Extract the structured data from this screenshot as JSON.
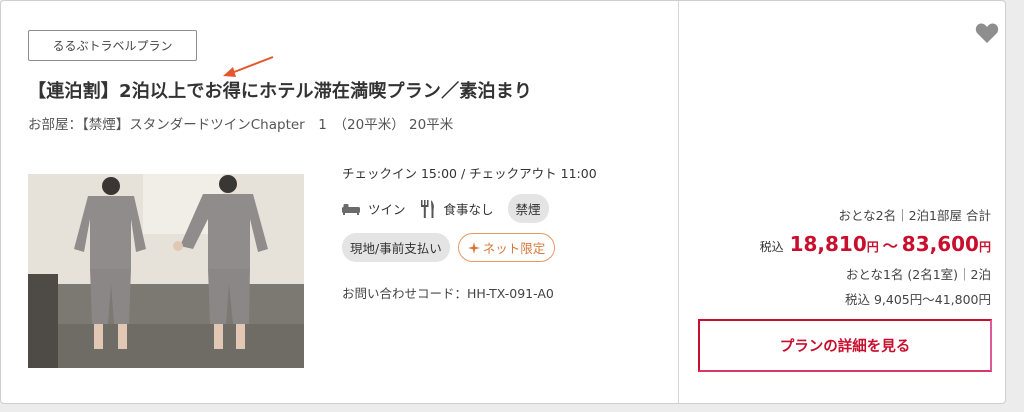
{
  "listing": {
    "brand_tag": "るるぶトラベルプラン",
    "plan_title": "【連泊割】2泊以上でお得にホテル滞在満喫プラン／素泊まり",
    "room_name": "お部屋：【禁煙】スタンダードツインChapter　1　（20平米） 20平米",
    "checkin_checkout": "チェックイン 15:00 / チェックアウト 11:00",
    "bed_type": "ツイン",
    "meal": "食事なし",
    "smoking": "禁煙",
    "payment": "現地/事前支払い",
    "net_only": "ネット限定",
    "inquiry_code": "お問い合わせコード：HH-TX-091-A0"
  },
  "pricing": {
    "occupancy": "おとな2名｜2泊1部屋 合計",
    "tax_label": "税込",
    "price_min": "18,810",
    "price_max": "83,600",
    "yen": "円",
    "tilde": "～",
    "per_person_label": "おとな1名 (2名1室)｜2泊",
    "per_person_price": "税込  9,405円～41,800円",
    "detail_button": "プランの詳細を見る"
  },
  "colors": {
    "accent_red": "#c8102e",
    "net_orange": "#d9763a",
    "arrow_red": "#e4572e"
  },
  "icons": {
    "favorite": "heart-icon",
    "bed": "bed-icon",
    "meal": "fork-knife-icon",
    "net": "sparkle-icon"
  }
}
